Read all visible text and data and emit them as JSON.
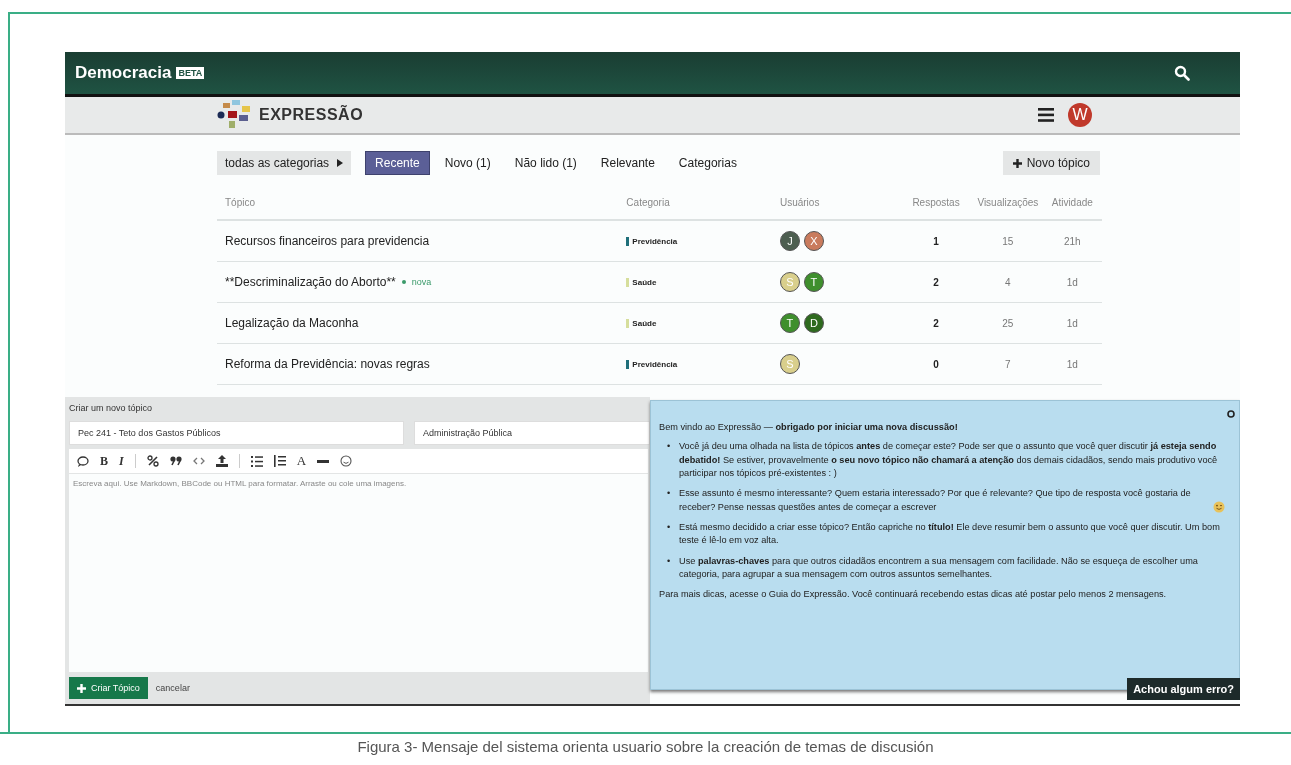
{
  "topbar": {
    "brand": "Democracia",
    "badge": "BETA"
  },
  "header": {
    "title": "EXPRESSÃO",
    "avatar": "W"
  },
  "nav": {
    "dropdown": "todas as categorias",
    "tabs": [
      {
        "label": "Recente",
        "selected": true
      },
      {
        "label": "Novo (1)",
        "selected": false
      },
      {
        "label": "Não lido (1)",
        "selected": false
      },
      {
        "label": "Relevante",
        "selected": false
      },
      {
        "label": "Categorias",
        "selected": false
      }
    ],
    "new_topic": "Novo tópico"
  },
  "table": {
    "columns": [
      "Tópico",
      "Categoria",
      "Usuários",
      "Respostas",
      "Visualizações",
      "Atividade"
    ],
    "rows": [
      {
        "topic": "Recursos financeiros para previdencia",
        "badge": "",
        "category": {
          "name": "Previdência",
          "color": "#1f6f7a"
        },
        "users": [
          {
            "letter": "J",
            "color": "#4d5e50"
          },
          {
            "letter": "X",
            "color": "#c97b5d"
          }
        ],
        "replies": "1",
        "views": "15",
        "activity": "21h"
      },
      {
        "topic": "**Descriminalização do Aborto**",
        "badge": "nova",
        "category": {
          "name": "Saúde",
          "color": "#d6de9c"
        },
        "users": [
          {
            "letter": "S",
            "color": "#d9cf8c"
          },
          {
            "letter": "T",
            "color": "#3f8f2d"
          }
        ],
        "replies": "2",
        "views": "4",
        "activity": "1d"
      },
      {
        "topic": "Legalização da Maconha",
        "badge": "",
        "category": {
          "name": "Saúde",
          "color": "#d6de9c"
        },
        "users": [
          {
            "letter": "T",
            "color": "#3f8f2d"
          },
          {
            "letter": "D",
            "color": "#2e6a1e"
          }
        ],
        "replies": "2",
        "views": "25",
        "activity": "1d"
      },
      {
        "topic": "Reforma da Previdência: novas regras",
        "badge": "",
        "category": {
          "name": "Previdência",
          "color": "#1f6f7a"
        },
        "users": [
          {
            "letter": "S",
            "color": "#d9cf8c"
          }
        ],
        "replies": "0",
        "views": "7",
        "activity": "1d"
      }
    ]
  },
  "composer": {
    "heading": "Criar um novo tópico",
    "title_value": "Pec 241 - Teto dos Gastos Públicos",
    "category_value": "Administração Pública",
    "toolbar": [
      "B",
      "I",
      "A"
    ],
    "placeholder": "Escreva aqui. Use Markdown, BBCode ou HTML para formatar. Arraste ou cole uma imagens.",
    "submit": "Criar Tópico",
    "cancel": "cancelar"
  },
  "tips": {
    "intro": "Bem vindo ao Expressão — **obrigado por iniciar uma nova discussão!**",
    "items": [
      {
        "bullet": "•",
        "text": "Você já deu uma olhada na lista de tópicos **antes** de começar este? Pode ser que o assunto que você quer discutir **já esteja sendo debatido!** Se estiver, provavelmente **o seu novo tópico não chamará a atenção** dos demais cidadãos, sendo mais produtivo você participar nos tópicos pré-existentes : )",
        "emoji": false
      },
      {
        "bullet": "•",
        "text": "Esse assunto é mesmo interessante? Quem estaria interessado? Por que é relevante? Que tipo de resposta você gostaria de receber? Pense nessas questões antes de começar a escrever",
        "emoji": true
      },
      {
        "bullet": "•",
        "text": "Está mesmo decidido a criar esse tópico? Então capriche no **título!** Ele deve resumir bem o assunto que você quer discutir. Um bom teste é lê-lo em voz alta.",
        "emoji": false
      },
      {
        "bullet": "•",
        "text": "Use **palavras-chaves** para que outros cidadãos encontrem a sua mensagem com facilidade. Não se esqueça de escolher uma categoria, para agrupar a sua mensagem com outros assuntos semelhantes.",
        "emoji": false
      }
    ],
    "footer": "Para mais dicas, acesse o Guia do Expressão. Você continuará recebendo estas dicas até postar pelo menos 2 mensagens."
  },
  "feedback_button": "Achou algum erro?",
  "caption": "Figura 3- Mensaje del sistema orienta usuario sobre la creación de temas de discusión"
}
